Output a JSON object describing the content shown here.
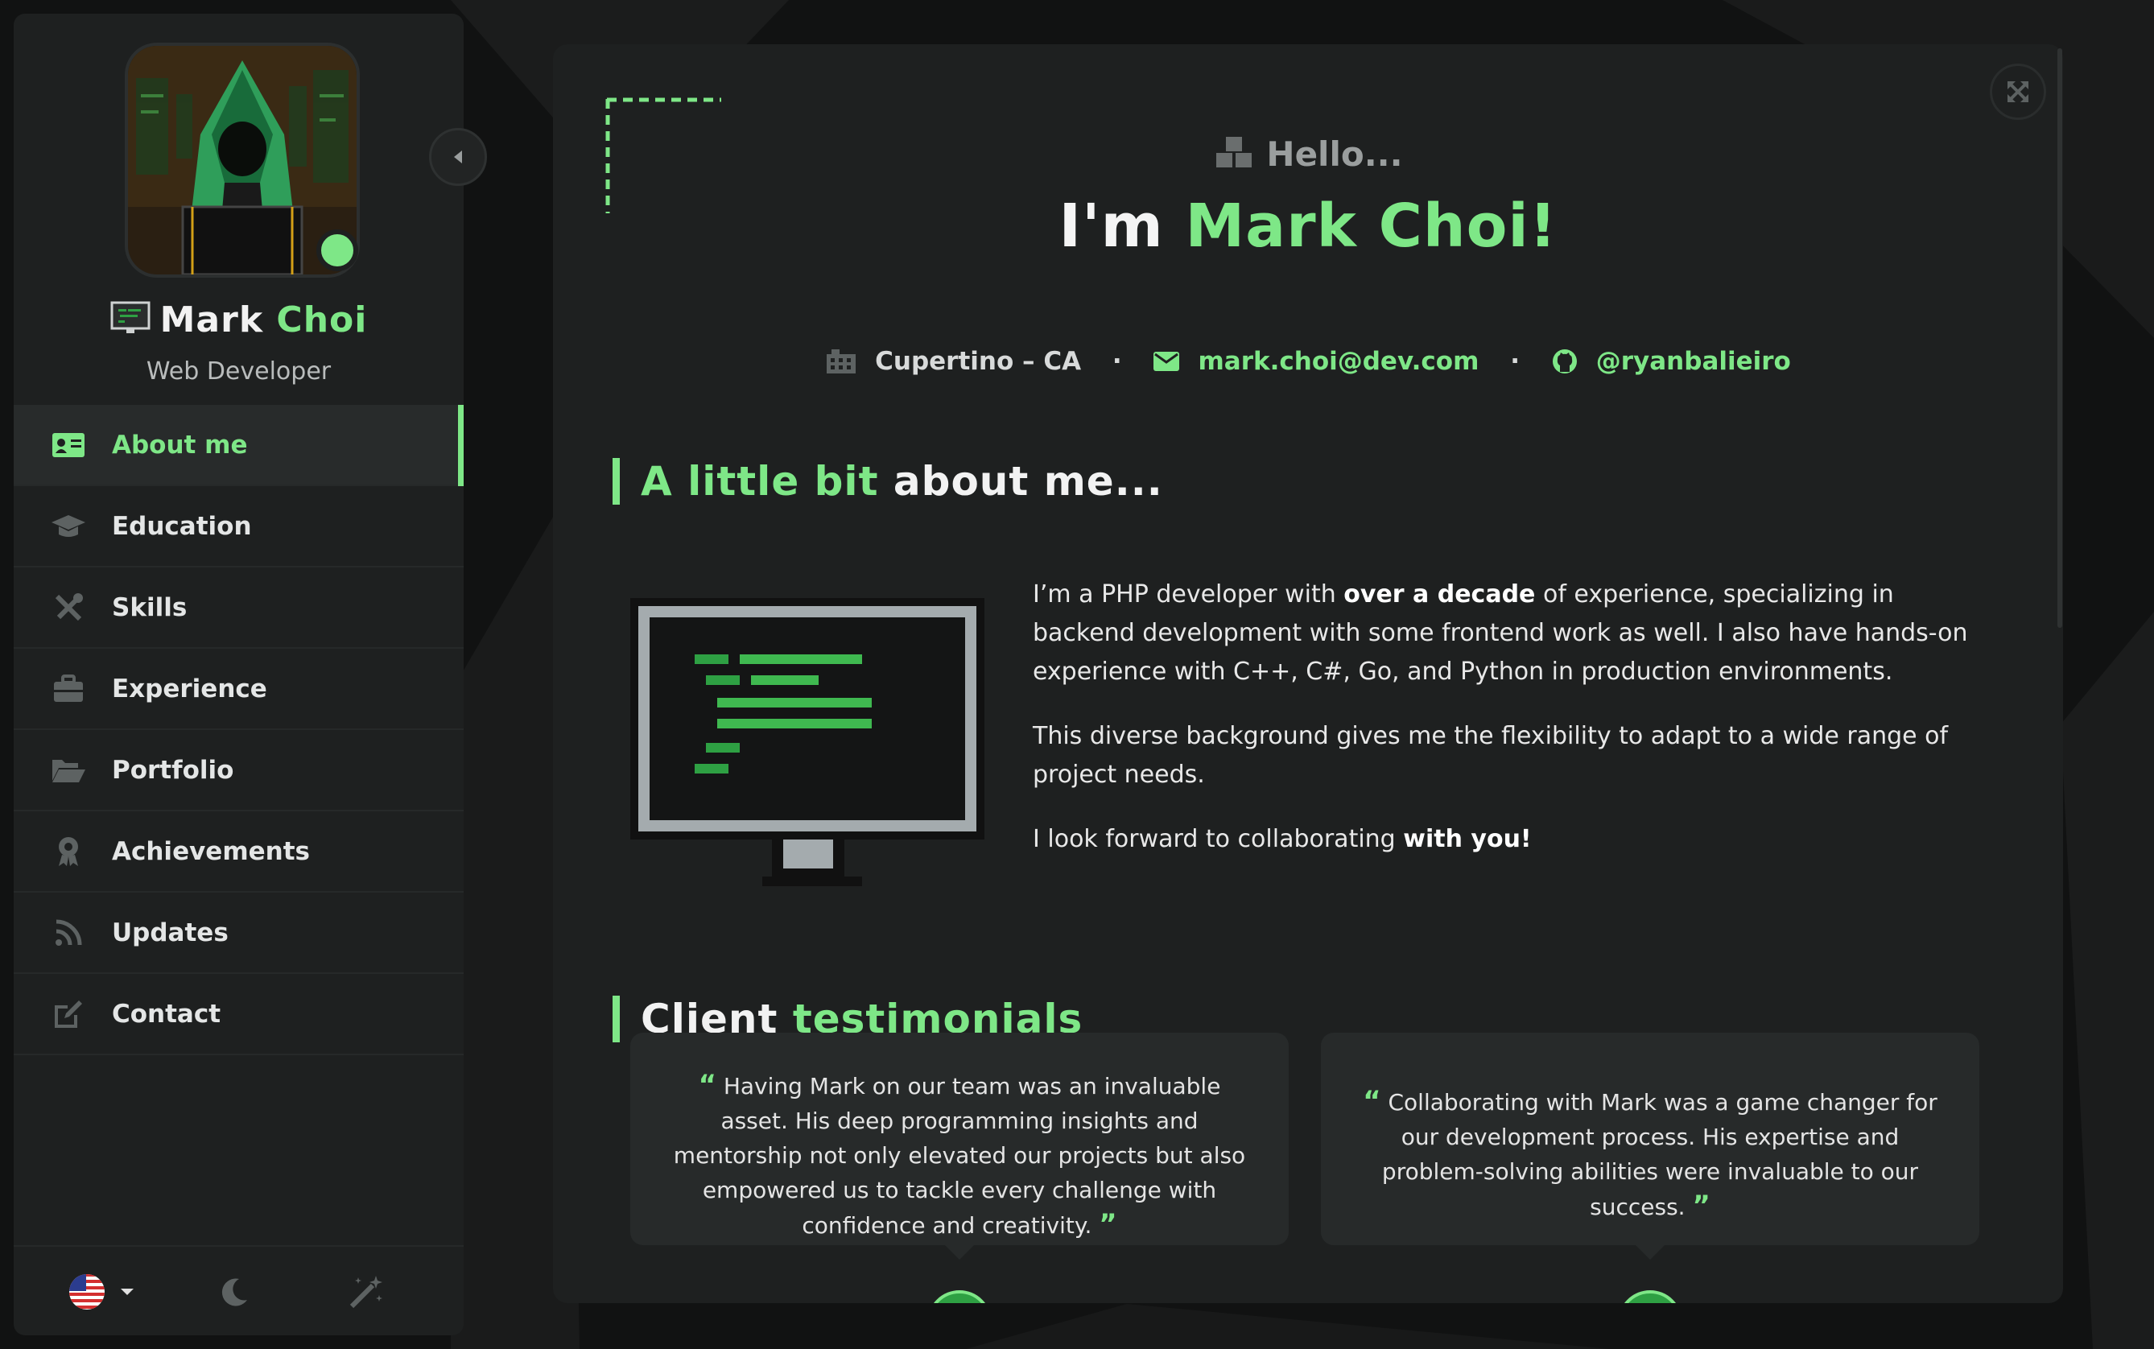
{
  "colors": {
    "accent": "#7ee787",
    "panel": "#1e2020",
    "background": "#111212"
  },
  "sidebar": {
    "name_first": "Mark",
    "name_last": "Choi",
    "role": "Web Developer",
    "items": [
      {
        "label": "About me",
        "icon": "id-card-icon",
        "active": true
      },
      {
        "label": "Education",
        "icon": "graduation-cap-icon"
      },
      {
        "label": "Skills",
        "icon": "tools-icon"
      },
      {
        "label": "Experience",
        "icon": "briefcase-icon"
      },
      {
        "label": "Portfolio",
        "icon": "folder-open-icon"
      },
      {
        "label": "Achievements",
        "icon": "award-icon"
      },
      {
        "label": "Updates",
        "icon": "rss-icon"
      },
      {
        "label": "Contact",
        "icon": "edit-icon"
      }
    ],
    "footer": {
      "language": "us-flag-icon",
      "theme": "moon-icon",
      "effects": "magic-wand-icon"
    }
  },
  "main": {
    "hello": "Hello...",
    "headline_prefix": "I'm",
    "headline_name": "Mark Choi!",
    "location": "Cupertino – CA",
    "email": "mark.choi@dev.com",
    "github": "@ryanbalieiro",
    "about": {
      "title_green": "A little bit",
      "title_white": "about me...",
      "p1_a": "I’m a PHP developer with ",
      "p1_b": "over a decade",
      "p1_c": " of experience, specializing in backend development with some frontend work as well. I also have hands-on experience with C++, C#, Go, and Python in production environments.",
      "p2": "This diverse background gives me the flexibility to adapt to a wide range of project needs.",
      "p3_a": "I look forward to collaborating ",
      "p3_b": "with you!"
    },
    "testimonials": {
      "title_white": "Client",
      "title_green": "testimonials",
      "items": [
        {
          "text": "Having Mark on our team was an invaluable asset. His deep programming insights and mentorship not only elevated our projects but also empowered us to tackle every challenge with confidence and creativity."
        },
        {
          "text": "Collaborating with Mark was a game changer for our development process. His expertise and problem-solving abilities were invaluable to our success."
        }
      ]
    }
  }
}
